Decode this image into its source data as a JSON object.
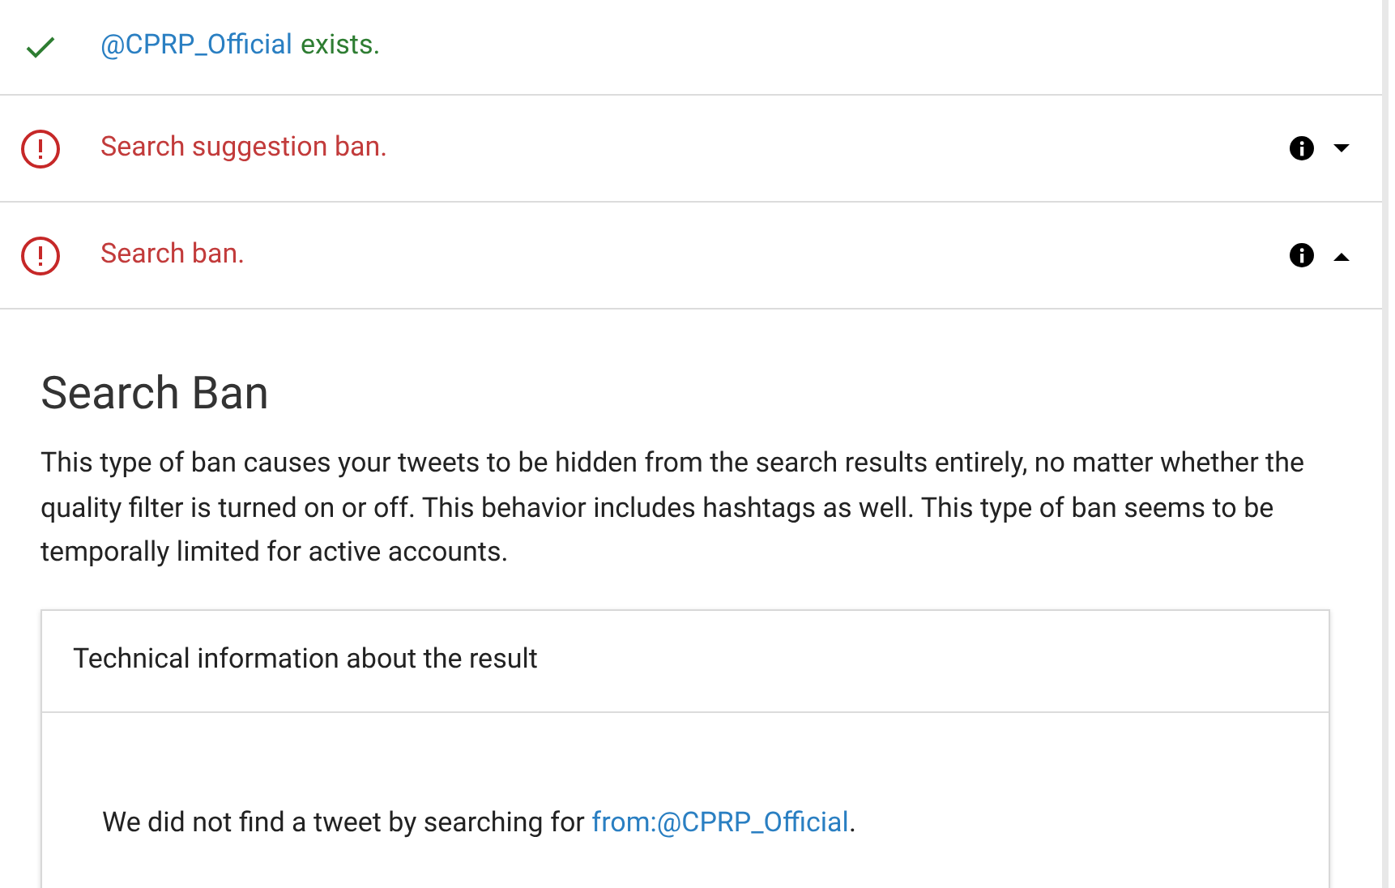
{
  "results": [
    {
      "kind": "ok",
      "handle": "@CPRP_Official",
      "text": "exists."
    },
    {
      "kind": "ban",
      "text": "Search suggestion ban.",
      "expanded": false
    },
    {
      "kind": "ban",
      "text": "Search ban.",
      "expanded": true
    }
  ],
  "details": {
    "title": "Search Ban",
    "description": "This type of ban causes your tweets to be hidden from the search results entirely, no matter whether the quality filter is turned on or off. This behavior includes hashtags as well. This type of ban seems to be temporally limited for active accounts.",
    "card": {
      "title": "Technical information about the result",
      "text": "We did not find a tweet by searching for",
      "query": "from:@CPRP_Official",
      "after": "."
    }
  }
}
